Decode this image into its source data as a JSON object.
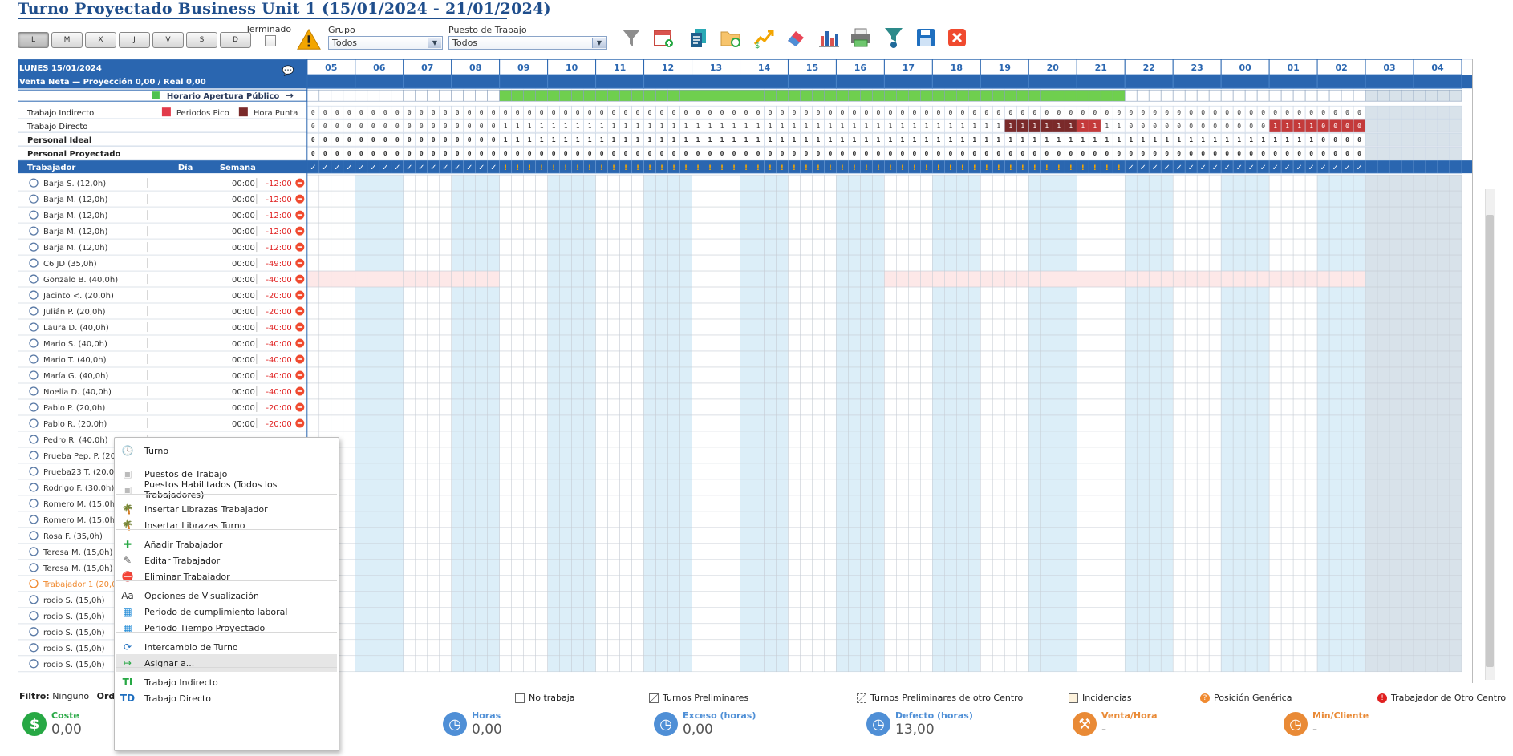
{
  "header": {
    "title": "Turno Proyectado Business Unit 1 (15/01/2024 - 21/01/2024)"
  },
  "days": [
    "L",
    "M",
    "X",
    "J",
    "V",
    "S",
    "D"
  ],
  "filters": {
    "terminado_label": "Terminado",
    "grupo_label": "Grupo",
    "grupo_value": "Todos",
    "puesto_label": "Puesto de Trabajo",
    "puesto_value": "Todos"
  },
  "toolbar": [
    "warning-icon",
    "filter-icon",
    "calendar-add-icon",
    "copy-icon",
    "folder-icon",
    "chart-up-icon",
    "eraser-icon",
    "bar-chart-icon",
    "printer-icon",
    "funnel-gear-icon",
    "save-icon",
    "close-icon"
  ],
  "grid": {
    "date_label": "LUNES 15/01/2024",
    "sales_label": "Venta Neta  —  Proyección 0,00  /  Real 0,00",
    "opening_label": "Horario Apertura Público",
    "hours": [
      "05",
      "06",
      "07",
      "08",
      "09",
      "10",
      "11",
      "12",
      "13",
      "14",
      "15",
      "16",
      "17",
      "18",
      "19",
      "20",
      "21",
      "22",
      "23",
      "00",
      "01",
      "02",
      "03",
      "04"
    ],
    "summary_rows": [
      "Trabajo Indirecto",
      "Trabajo Directo",
      "Personal Ideal",
      "Personal Proyectado"
    ],
    "legend_pico": "Periodos Pico",
    "legend_punta": "Hora Punta",
    "cols": {
      "worker": "Trabajador",
      "dia": "Día",
      "semana": "Semana"
    },
    "workers": [
      {
        "name": "Barja S. (12,0h)",
        "time": "00:00",
        "bal": "-12:00"
      },
      {
        "name": "Barja M. (12,0h)",
        "time": "00:00",
        "bal": "-12:00"
      },
      {
        "name": "Barja M. (12,0h)",
        "time": "00:00",
        "bal": "-12:00"
      },
      {
        "name": "Barja M. (12,0h)",
        "time": "00:00",
        "bal": "-12:00"
      },
      {
        "name": "Barja M. (12,0h)",
        "time": "00:00",
        "bal": "-12:00"
      },
      {
        "name": "C6 JD (35,0h)",
        "time": "00:00",
        "bal": "-49:00"
      },
      {
        "name": "Gonzalo B. (40,0h)",
        "time": "00:00",
        "bal": "-40:00"
      },
      {
        "name": "Jacinto <. (20,0h)",
        "time": "00:00",
        "bal": "-20:00"
      },
      {
        "name": "Julián P. (20,0h)",
        "time": "00:00",
        "bal": "-20:00"
      },
      {
        "name": "Laura D. (40,0h)",
        "time": "00:00",
        "bal": "-40:00"
      },
      {
        "name": "Mario S. (40,0h)",
        "time": "00:00",
        "bal": "-40:00"
      },
      {
        "name": "Mario T. (40,0h)",
        "time": "00:00",
        "bal": "-40:00"
      },
      {
        "name": "María G. (40,0h)",
        "time": "00:00",
        "bal": "-40:00"
      },
      {
        "name": "Noelia D. (40,0h)",
        "time": "00:00",
        "bal": "-40:00"
      },
      {
        "name": "Pablo P. (20,0h)",
        "time": "00:00",
        "bal": "-20:00"
      },
      {
        "name": "Pablo R. (20,0h)",
        "time": "00:00",
        "bal": "-20:00"
      },
      {
        "name": "Pedro R. (40,0h)",
        "time": "",
        "bal": ""
      },
      {
        "name": "Prueba Pep. P. (20,0h)",
        "time": "",
        "bal": ""
      },
      {
        "name": "Prueba23 T. (20,0h)",
        "time": "",
        "bal": ""
      },
      {
        "name": "Rodrigo F. (30,0h)",
        "time": "",
        "bal": ""
      },
      {
        "name": "Romero M. (15,0h)",
        "time": "",
        "bal": ""
      },
      {
        "name": "Romero M. (15,0h)",
        "time": "",
        "bal": ""
      },
      {
        "name": "Rosa F. (35,0h)",
        "time": "",
        "bal": ""
      },
      {
        "name": "Teresa M. (15,0h)",
        "time": "",
        "bal": ""
      },
      {
        "name": "Teresa M. (15,0h)",
        "time": "",
        "bal": ""
      },
      {
        "name": "Trabajador 1 (20,0h)",
        "time": "",
        "bal": ""
      },
      {
        "name": "rocio S. (15,0h)",
        "time": "",
        "bal": ""
      },
      {
        "name": "rocio S. (15,0h)",
        "time": "",
        "bal": ""
      },
      {
        "name": "rocio S. (15,0h)",
        "time": "",
        "bal": ""
      },
      {
        "name": "rocio S. (15,0h)",
        "time": "",
        "bal": ""
      },
      {
        "name": "rocio S. (15,0h)",
        "time": "",
        "bal": ""
      }
    ]
  },
  "context_menu": [
    {
      "label": "Turno",
      "icon": "clock-icon"
    },
    {
      "label": "Puestos de Trabajo",
      "icon": "briefcase-icon"
    },
    {
      "label": "Puestos Habilitados (Todos los Trabajadores)",
      "icon": "briefcase-icon"
    },
    {
      "label": "Insertar Librazas Trabajador",
      "icon": "beach-icon"
    },
    {
      "label": "Insertar Librazas Turno",
      "icon": "beach-icon"
    },
    {
      "label": "Añadir Trabajador",
      "icon": "add-icon"
    },
    {
      "label": "Editar Trabajador",
      "icon": "edit-icon"
    },
    {
      "label": "Eliminar Trabajador",
      "icon": "delete-icon"
    },
    {
      "label": "Opciones de Visualización",
      "icon": "font-icon"
    },
    {
      "label": "Periodo de cumplimiento laboral",
      "icon": "calendar-icon"
    },
    {
      "label": "Periodo Tiempo Proyectado",
      "icon": "calendar-icon"
    },
    {
      "label": "Intercambio de Turno",
      "icon": "swap-icon"
    },
    {
      "label": "Asignar a...",
      "icon": "assign-icon"
    },
    {
      "label": "Trabajo Indirecto",
      "icon": "ti-icon"
    },
    {
      "label": "Trabajo Directo",
      "icon": "td-icon"
    }
  ],
  "bottom": {
    "filter_label": "Filtro:",
    "filter_value": "Ninguno",
    "order_label": "Orde",
    "legend": [
      "No trabaja",
      "Turnos Preliminares",
      "Turnos Preliminares de otro Centro",
      "Incidencias",
      "Posición Genérica",
      "Trabajador de Otro Centro"
    ],
    "kpis": [
      {
        "label": "Coste",
        "value": "0,00",
        "color": "#27a844",
        "icon": "$"
      },
      {
        "label": "Horas",
        "value": "0,00",
        "color": "#4f8fd6",
        "icon": "◷"
      },
      {
        "label": "Exceso (horas)",
        "value": "0,00",
        "color": "#4f8fd6",
        "icon": "◷"
      },
      {
        "label": "Defecto (horas)",
        "value": "13,00",
        "color": "#4f8fd6",
        "icon": "◷"
      },
      {
        "label": "Venta/Hora",
        "value": "-",
        "color": "#e98a36",
        "icon": "⚒"
      },
      {
        "label": "Min/Cliente",
        "value": "-",
        "color": "#e98a36",
        "icon": "◷"
      }
    ]
  }
}
